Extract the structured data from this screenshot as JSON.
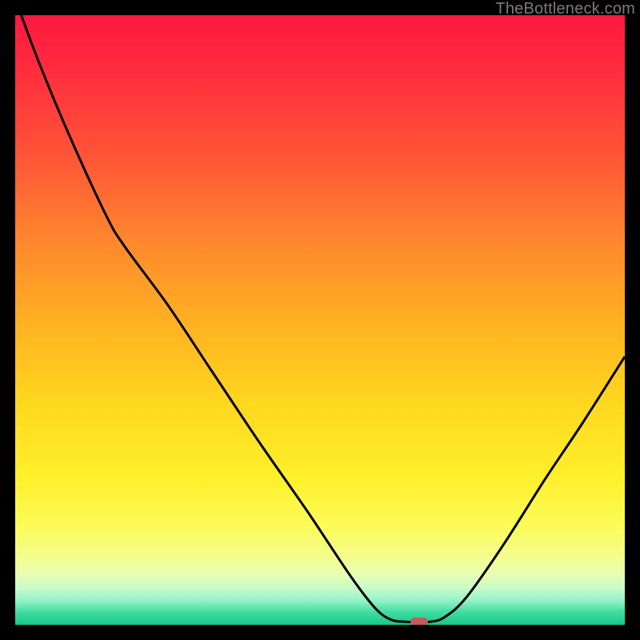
{
  "watermark": "TheBottleneck.com",
  "colors": {
    "frame": "#000000",
    "curve": "#000000",
    "marker": "#c65b5f",
    "gradient_stops": [
      {
        "pct": 0,
        "hex": "#ff1740"
      },
      {
        "pct": 8,
        "hex": "#ff2a3f"
      },
      {
        "pct": 22,
        "hex": "#ff5138"
      },
      {
        "pct": 38,
        "hex": "#ff8a2d"
      },
      {
        "pct": 52,
        "hex": "#ffb521"
      },
      {
        "pct": 64,
        "hex": "#ffd81f"
      },
      {
        "pct": 76,
        "hex": "#fff02c"
      },
      {
        "pct": 84,
        "hex": "#fbfc5a"
      },
      {
        "pct": 89,
        "hex": "#f4fd90"
      },
      {
        "pct": 92,
        "hex": "#e5fdb5"
      },
      {
        "pct": 94,
        "hex": "#c7fbc9"
      },
      {
        "pct": 96,
        "hex": "#94f3c8"
      },
      {
        "pct": 98,
        "hex": "#3fdba0"
      },
      {
        "pct": 100,
        "hex": "#16c888"
      }
    ]
  },
  "chart_data": {
    "type": "line",
    "title": "",
    "xlabel": "",
    "ylabel": "",
    "xlim": [
      0,
      100
    ],
    "ylim": [
      0,
      100
    ],
    "grid": false,
    "legend_position": "none",
    "series": [
      {
        "name": "bottleneck-curve",
        "points": [
          {
            "x": 1.0,
            "y": 100.0
          },
          {
            "x": 4.0,
            "y": 92.0
          },
          {
            "x": 9.0,
            "y": 80.0
          },
          {
            "x": 15.0,
            "y": 67.0
          },
          {
            "x": 18.0,
            "y": 62.0
          },
          {
            "x": 25.0,
            "y": 52.5
          },
          {
            "x": 32.0,
            "y": 42.0
          },
          {
            "x": 40.0,
            "y": 30.0
          },
          {
            "x": 48.0,
            "y": 18.5
          },
          {
            "x": 55.0,
            "y": 8.0
          },
          {
            "x": 59.0,
            "y": 2.8
          },
          {
            "x": 61.5,
            "y": 0.9
          },
          {
            "x": 64.0,
            "y": 0.5
          },
          {
            "x": 68.0,
            "y": 0.5
          },
          {
            "x": 70.5,
            "y": 1.3
          },
          {
            "x": 74.0,
            "y": 4.5
          },
          {
            "x": 80.0,
            "y": 13.0
          },
          {
            "x": 87.0,
            "y": 24.0
          },
          {
            "x": 93.0,
            "y": 33.0
          },
          {
            "x": 100.0,
            "y": 44.0
          }
        ]
      }
    ],
    "marker": {
      "x": 66.3,
      "y": 0.5
    }
  }
}
